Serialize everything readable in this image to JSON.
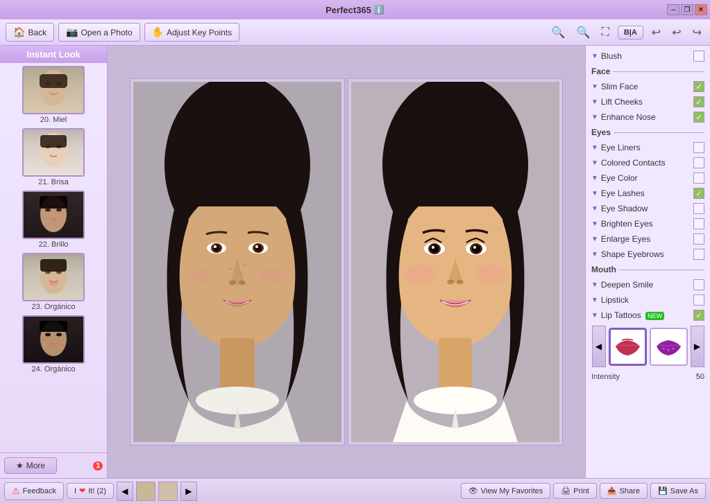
{
  "app": {
    "title": "Perfect365",
    "info_icon": "ℹ️"
  },
  "window_controls": {
    "minimize": "–",
    "restore": "❐",
    "close": "✕"
  },
  "toolbar": {
    "back_label": "Back",
    "open_photo_label": "Open a Photo",
    "adjust_key_points_label": "Adjust Key Points",
    "zoom_in_icon": "⊕",
    "zoom_out_icon": "⊖",
    "resize_icon": "⛶",
    "bia_label": "B|A",
    "undo_icon": "↩",
    "undo2_icon": "↪",
    "redo_icon": "↪"
  },
  "sidebar": {
    "header": "Instant Look",
    "items": [
      {
        "number": "20.",
        "name": "Miel",
        "label": "20. Miel",
        "style": "light"
      },
      {
        "number": "21.",
        "name": "Brisa",
        "label": "21. Brisa",
        "style": "light"
      },
      {
        "number": "22.",
        "name": "Brillo",
        "label": "22. Brillo",
        "style": "dark"
      },
      {
        "number": "23.",
        "name": "Orgánico",
        "label": "23. Orgánico",
        "style": "light"
      },
      {
        "number": "24.",
        "name": "Orgánico",
        "label": "24. Orgánico",
        "style": "dark"
      }
    ],
    "more_label": "More",
    "more_badge": "1"
  },
  "right_panel": {
    "blush_label": "Blush",
    "face_section": "Face",
    "slim_face_label": "Slim Face",
    "slim_face_checked": true,
    "lift_cheeks_label": "Lift Cheeks",
    "lift_cheeks_checked": true,
    "enhance_nose_label": "Enhance Nose",
    "enhance_nose_checked": true,
    "eyes_section": "Eyes",
    "eye_liners_label": "Eye Liners",
    "eye_liners_checked": false,
    "colored_contacts_label": "Colored Contacts",
    "colored_contacts_checked": false,
    "eye_color_label": "Eye Color",
    "eye_color_checked": false,
    "eye_lashes_label": "Eye Lashes",
    "eye_lashes_checked": true,
    "eye_shadow_label": "Eye Shadow",
    "eye_shadow_checked": false,
    "brighten_eyes_label": "Brighten Eyes",
    "brighten_eyes_checked": false,
    "enlarge_eyes_label": "Enlarge Eyes",
    "enlarge_eyes_checked": false,
    "shape_eyebrows_label": "Shape Eyebrows",
    "shape_eyebrows_checked": false,
    "mouth_section": "Mouth",
    "deepen_smile_label": "Deepen Smile",
    "deepen_smile_checked": false,
    "lipstick_label": "Lipstick",
    "lipstick_checked": false,
    "lip_tattoos_label": "Lip Tattoos",
    "lip_tattoos_new": "NEW",
    "lip_tattoos_checked": true,
    "intensity_label": "Intensity",
    "intensity_value": "50"
  },
  "bottom_bar": {
    "feedback_label": "Feedback",
    "i_love_it_label": "I",
    "love_it_label": "It! (2)",
    "view_favorites_label": "View My Favorites",
    "print_label": "Print",
    "share_label": "Share",
    "save_as_label": "Save As",
    "nav_left": "◀",
    "nav_right": "▶"
  }
}
